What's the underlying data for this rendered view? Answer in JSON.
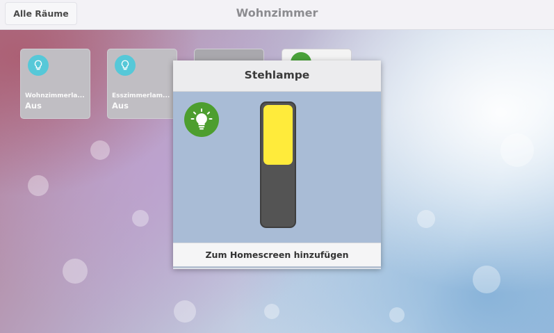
{
  "header": {
    "back_label": "Alle Räume",
    "title": "Wohnzimmer"
  },
  "tiles": [
    {
      "name": "Wohnzimmerla...",
      "state": "Aus",
      "icon": "lightbulb-icon"
    },
    {
      "name": "Esszimmerlam...",
      "state": "Aus",
      "icon": "lightbulb-icon"
    },
    {
      "name": "",
      "state": "",
      "icon": ""
    },
    {
      "name": "",
      "state": "",
      "icon": "lightbulb-icon"
    }
  ],
  "dialog": {
    "title": "Stehlampe",
    "icon": "lightbulb-icon",
    "slider_level": 0.5,
    "add_to_homescreen_label": "Zum Homescreen hinzufügen"
  },
  "colors": {
    "accent_on": "#4d9e2f",
    "tile_icon": "#56c8d8",
    "slider_fill": "#ffeb3b"
  }
}
